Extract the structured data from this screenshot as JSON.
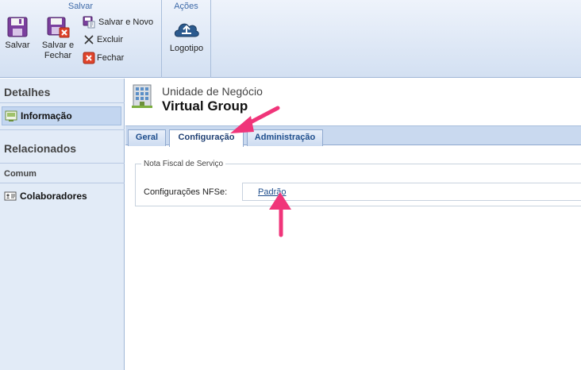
{
  "ribbon": {
    "groups": {
      "salvar": "Salvar",
      "acoes": "Ações"
    },
    "buttons": {
      "salvar": "Salvar",
      "salvar_fechar_line1": "Salvar e",
      "salvar_fechar_line2": "Fechar",
      "salvar_novo": "Salvar e Novo",
      "excluir": "Excluir",
      "fechar": "Fechar",
      "logotipo": "Logotipo"
    }
  },
  "sidebar": {
    "detalhes_title": "Detalhes",
    "informacao": "Informação",
    "relacionados_title": "Relacionados",
    "comum_title": "Comum",
    "colaboradores": "Colaboradores"
  },
  "header": {
    "entity_type": "Unidade de Negócio",
    "entity_name": "Virtual Group"
  },
  "tabs": [
    {
      "label": "Geral",
      "active": false
    },
    {
      "label": "Configuração",
      "active": true
    },
    {
      "label": "Administração",
      "active": false
    }
  ],
  "section": {
    "legend": "Nota Fiscal de Serviço",
    "field_label": "Configurações NFSe:",
    "field_value": "Padrão"
  },
  "colors": {
    "accent": "#1f4e8c",
    "annotation_arrow": "#f0357a",
    "sidebar_bg": "#e2ebf7"
  },
  "icons": [
    "save-icon",
    "save-close-icon",
    "save-new-icon",
    "delete-icon",
    "close-icon",
    "logo-upload-icon",
    "building-icon",
    "info-icon",
    "contacts-icon"
  ]
}
